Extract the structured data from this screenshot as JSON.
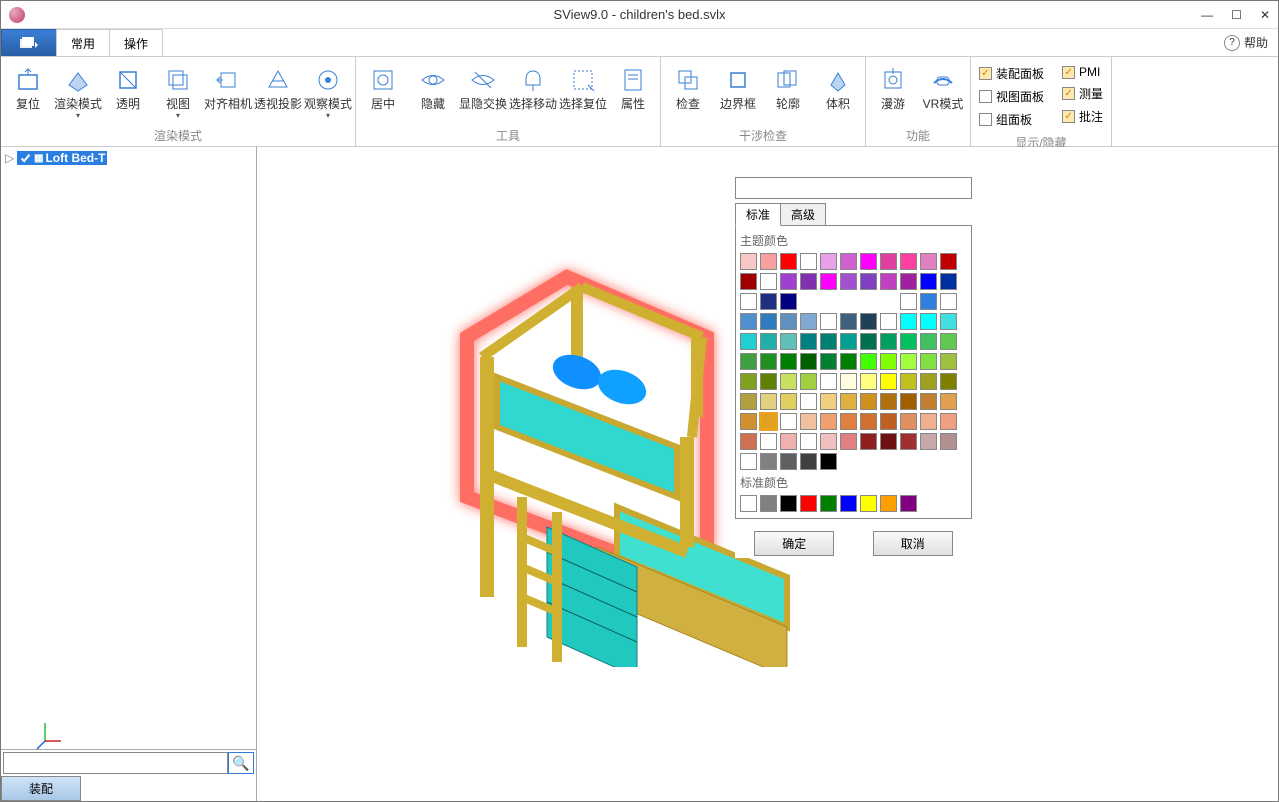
{
  "title": "SView9.0 - children's bed.svlx",
  "menu": {
    "tab1": "常用",
    "tab2": "操作",
    "help": "帮助"
  },
  "ribbon": {
    "g1": {
      "title": "渲染模式",
      "btns": [
        "复位",
        "渲染模式",
        "透明",
        "视图",
        "对齐相机",
        "透视投影",
        "观察模式"
      ],
      "dd": [
        false,
        true,
        false,
        true,
        false,
        false,
        true
      ]
    },
    "g2": {
      "title": "工具",
      "btns": [
        "居中",
        "隐藏",
        "显隐交换",
        "选择移动",
        "选择复位",
        "属性"
      ]
    },
    "g3": {
      "title": "干涉检查",
      "btns": [
        "检查",
        "边界框",
        "轮廓",
        "体积"
      ]
    },
    "g4": {
      "title": "功能",
      "btns": [
        "漫游",
        "VR模式"
      ]
    },
    "checks": {
      "title": "显示/隐藏",
      "left": [
        {
          "label": "装配面板",
          "checked": true
        },
        {
          "label": "视图面板",
          "checked": false
        },
        {
          "label": "组面板",
          "checked": false
        }
      ],
      "right": [
        {
          "label": "PMI",
          "checked": true
        },
        {
          "label": "测量",
          "checked": true
        },
        {
          "label": "批注",
          "checked": true
        }
      ]
    }
  },
  "tree": {
    "node": "Loft Bed-T"
  },
  "assembly_tab": "装配",
  "picker": {
    "tab_std": "标准",
    "tab_adv": "高级",
    "theme_title": "主题颜色",
    "std_title": "标准颜色",
    "ok": "确定",
    "cancel": "取消",
    "theme_colors": [
      "#f8c8c8",
      "#f8a0a0",
      "#ff0000",
      "#ffffff",
      "#e8a0e8",
      "#d060d0",
      "#ff00ff",
      "#e040a0",
      "#ff40a0",
      "#e080c0",
      "#c00000",
      "#a00000",
      "#ffffff",
      "#a040d0",
      "#8030b0",
      "#ff00ff",
      "#a050d0",
      "#8040c0",
      "#c040c0",
      "#a020a0",
      "#0000ff",
      "#0030a0",
      "#ffffff",
      "#203080",
      "#000080",
      "#ffffff",
      "#ffffff",
      "#ffffff",
      "#ffffff",
      "#ffffff",
      "#ffffff",
      "#3080e0",
      "#ffffff",
      "#5090d0",
      "#307cc0",
      "#6090c0",
      "#80a8d0",
      "#ffffff",
      "#406080",
      "#204058",
      "#ffffff",
      "#00ffff",
      "#00ffff",
      "#40e0e0",
      "#20d0d0",
      "#20b0a8",
      "#60c0b8",
      "#008080",
      "#008070",
      "#00a090",
      "#007050",
      "#00a060",
      "#00c060",
      "#40c060",
      "#60c850",
      "#40a040",
      "#209020",
      "#008000",
      "#006000",
      "#008030",
      "#008000",
      "#40ff00",
      "#80ff00",
      "#a0ff40",
      "#80e040",
      "#a0c040",
      "#80a020",
      "#608000",
      "#c8e060",
      "#a0d040",
      "#ffffff",
      "#ffffe0",
      "#ffff80",
      "#ffff00",
      "#c0c020",
      "#a0a020",
      "#808000",
      "#b0a040",
      "#e0d080",
      "#e0d060",
      "#ffffff",
      "#f0d080",
      "#e0b040",
      "#d09020",
      "#b07010",
      "#a06000",
      "#c08030",
      "#e0a050",
      "#d09030",
      "#e0a020",
      "#ffffff",
      "#f0c0a0",
      "#f0a070",
      "#e08040",
      "#d07030",
      "#c06020",
      "#e09060",
      "#f0b090",
      "#f0a080",
      "#d07050",
      "#ffffff",
      "#f0b0b0",
      "#ffffff",
      "#f0c0c0",
      "#e08080",
      "#902020",
      "#701010",
      "#a03030",
      "#c8a8a8",
      "#b09090",
      "#ffffff",
      "#808080",
      "#606060",
      "#404040",
      "#000000",
      "#ffffff",
      "#ffffff",
      "#ffffff",
      "#ffffff",
      "#ffffff"
    ],
    "theme_sel": 89,
    "std_colors": [
      "#ffffff",
      "#808080",
      "#000000",
      "#ff0000",
      "#008000",
      "#0000ff",
      "#ffff00",
      "#ffa000",
      "#800080"
    ]
  }
}
